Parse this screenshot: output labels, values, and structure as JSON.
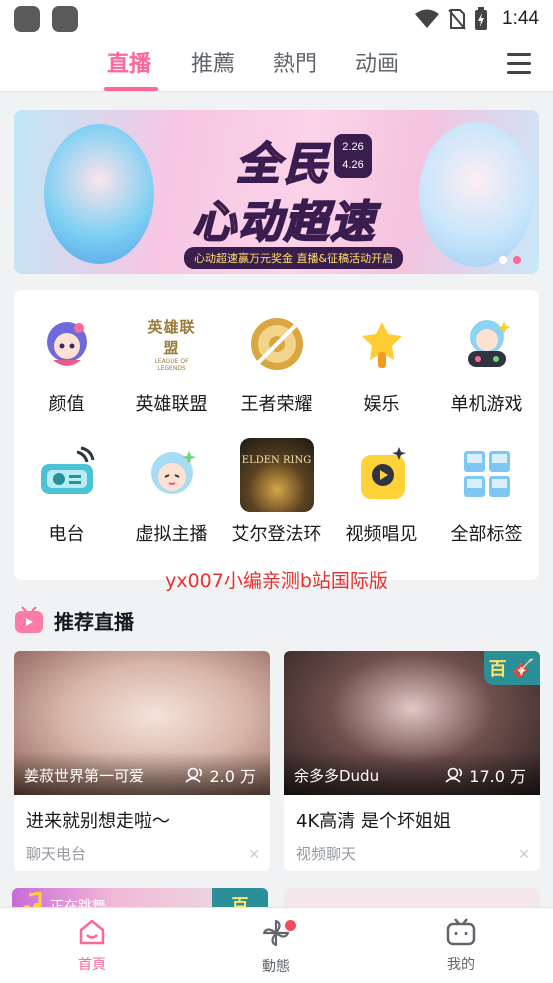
{
  "status_bar": {
    "time": "1:44"
  },
  "top_tabs": [
    {
      "label": "直播",
      "active": true
    },
    {
      "label": "推薦",
      "active": false
    },
    {
      "label": "熱門",
      "active": false
    },
    {
      "label": "动画",
      "active": false
    }
  ],
  "banner": {
    "title_line1": "全民",
    "title_line2": "心动超速",
    "date_start": "2.26",
    "date_end": "4.26",
    "subtitle": "心动超速赢万元奖金 直播&征稿活动开启",
    "slide_count": 2,
    "active_slide": 2
  },
  "categories": [
    {
      "label": "颜值",
      "icon": "avatar-girl-icon"
    },
    {
      "label": "英雄联盟",
      "icon": "league-of-legends-logo-icon",
      "logo_text": "英雄联盟",
      "logo_subtext": "LEAGUE OF LEGENDS"
    },
    {
      "label": "王者荣耀",
      "icon": "honor-of-kings-logo-icon"
    },
    {
      "label": "娱乐",
      "icon": "microphone-icon"
    },
    {
      "label": "单机游戏",
      "icon": "gamepad-girl-icon"
    },
    {
      "label": "电台",
      "icon": "radio-icon"
    },
    {
      "label": "虚拟主播",
      "icon": "virtual-streamer-icon"
    },
    {
      "label": "艾尔登法环",
      "icon": "elden-ring-icon",
      "logo_text": "ELDEN RING"
    },
    {
      "label": "视频唱见",
      "icon": "singing-video-icon"
    },
    {
      "label": "全部标签",
      "icon": "all-tags-grid-icon"
    }
  ],
  "watermark": "yx007小编亲测b站国际版",
  "section": {
    "title": "推荐直播"
  },
  "live_cards": [
    {
      "anchor": "姜菽世界第一可爱",
      "viewers": "2.0 万",
      "title": "进来就别想走啦～",
      "area": "聊天电台",
      "badge": ""
    },
    {
      "anchor": "余多多Dudu",
      "viewers": "17.0 万",
      "title": "4K高清 是个坏姐姐",
      "area": "视频聊天",
      "badge": "百"
    }
  ],
  "peek_cards": [
    {
      "tag": "正在跳舞",
      "badge": "百"
    },
    {
      "tag": "",
      "badge": ""
    }
  ],
  "bottom_nav": [
    {
      "label": "首頁",
      "active": true,
      "icon": "home-icon"
    },
    {
      "label": "動態",
      "active": false,
      "icon": "pinwheel-icon",
      "has_dot": true
    },
    {
      "label": "我的",
      "active": false,
      "icon": "tv-profile-icon"
    }
  ],
  "colors": {
    "accent": "#ff6699",
    "text": "#18191c",
    "muted": "#9499a0",
    "background": "#f1f2f3",
    "badge": "#2a8f97"
  }
}
